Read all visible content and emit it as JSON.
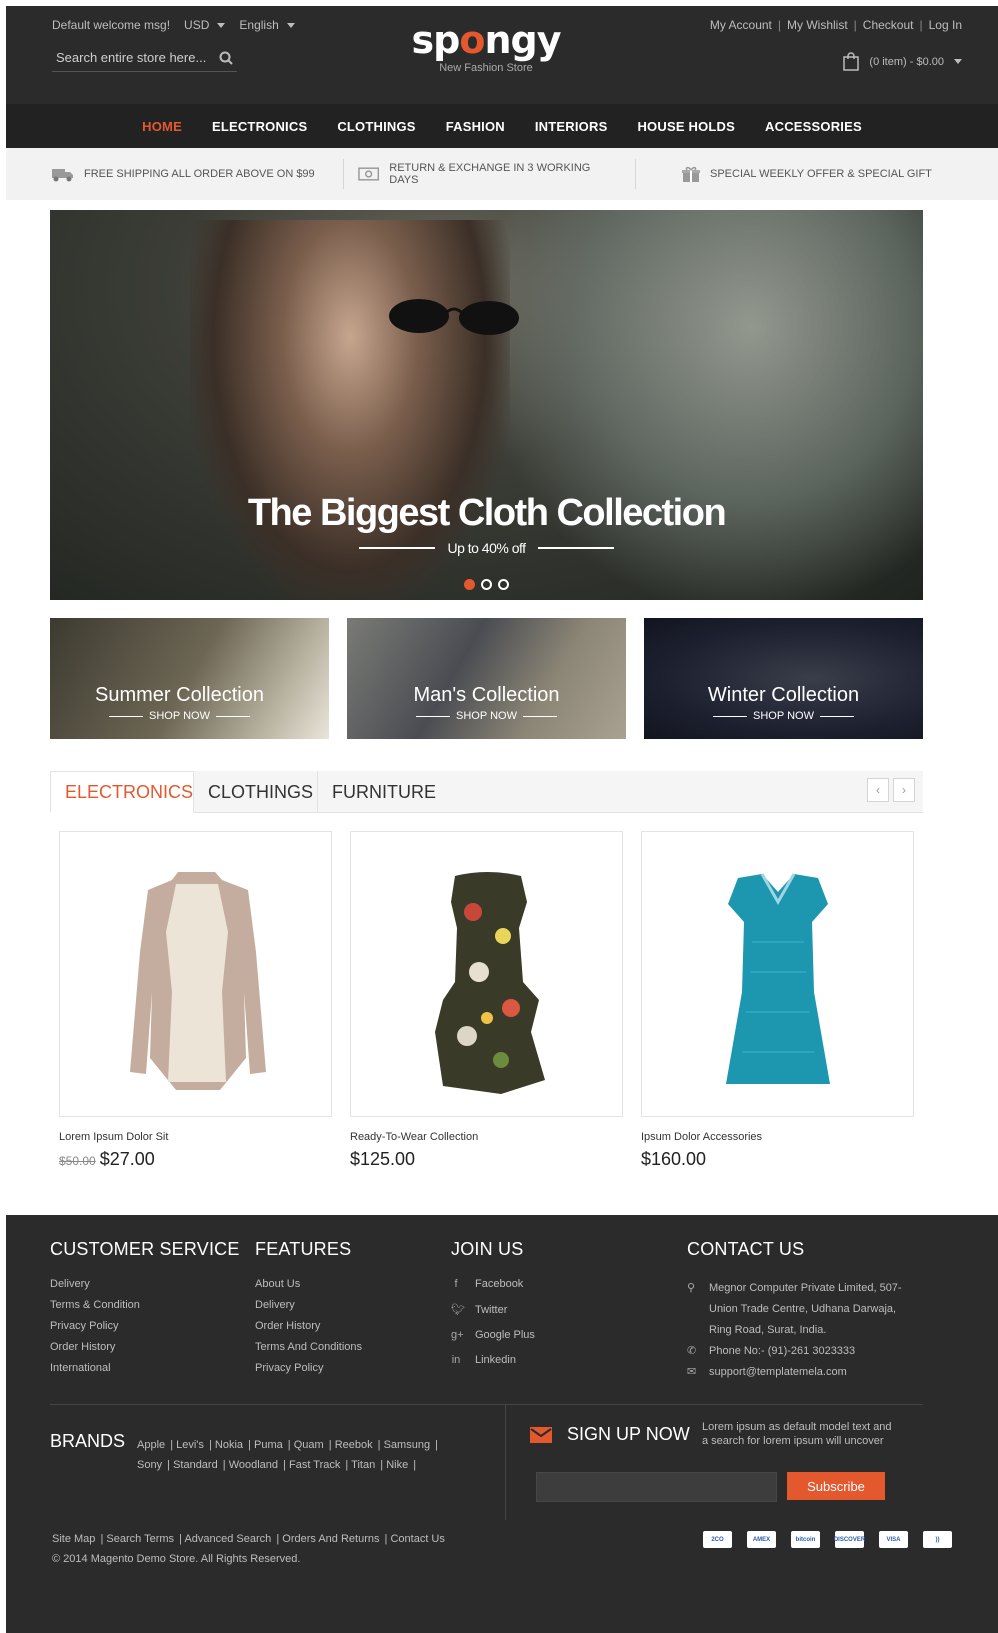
{
  "header": {
    "welcome": "Default welcome msg!",
    "currency": "USD",
    "language": "English",
    "search_placeholder": "Search entire store here...",
    "logo_text": "spongy",
    "logo_tagline": "New Fashion Store",
    "links": [
      "My Account",
      "My Wishlist",
      "Checkout",
      "Log In"
    ],
    "cart": "(0 item) - $0.00"
  },
  "nav": [
    "HOME",
    "ELECTRONICS",
    "CLOTHINGS",
    "FASHION",
    "INTERIORS",
    "HOUSE HOLDS",
    "ACCESSORIES"
  ],
  "features": [
    {
      "icon": "truck-icon",
      "text": "FREE SHIPPING ALL ORDER ABOVE ON $99"
    },
    {
      "icon": "money-icon",
      "text": "RETURN & EXCHANGE IN 3 WORKING DAYS"
    },
    {
      "icon": "gift-icon",
      "text": "SPECIAL WEEKLY OFFER & SPECIAL GIFT"
    }
  ],
  "hero": {
    "title": "The Biggest Cloth Collection",
    "subtitle": "Up to 40% off",
    "slides": 3,
    "active_slide": 1
  },
  "banners": [
    {
      "title": "Summer Collection",
      "cta": "SHOP NOW"
    },
    {
      "title": "Man's Collection",
      "cta": "SHOP NOW"
    },
    {
      "title": "Winter Collection",
      "cta": "SHOP NOW"
    }
  ],
  "tabs": [
    "ELECTRONICS",
    "CLOTHINGS",
    "FURNITURE"
  ],
  "products": [
    {
      "name": "Lorem Ipsum Dolor Sit",
      "old_price": "$50.00",
      "price": "$27.00"
    },
    {
      "name": "Ready-To-Wear Collection",
      "old_price": "",
      "price": "$125.00"
    },
    {
      "name": "Ipsum Dolor Accessories",
      "old_price": "",
      "price": "$160.00"
    }
  ],
  "footer": {
    "customer_service": {
      "title": "CUSTOMER SERVICE",
      "items": [
        "Delivery",
        "Terms & Condition",
        "Privacy Policy",
        "Order History",
        "International"
      ]
    },
    "features": {
      "title": "FEATURES",
      "items": [
        "About Us",
        "Delivery",
        "Order History",
        "Terms And Conditions",
        "Privacy Policy"
      ]
    },
    "join": {
      "title": "JOIN US",
      "items": [
        {
          "icon": "f",
          "label": "Facebook"
        },
        {
          "icon": "t",
          "label": "Twitter"
        },
        {
          "icon": "g+",
          "label": "Google Plus"
        },
        {
          "icon": "in",
          "label": "Linkedin"
        }
      ]
    },
    "contact": {
      "title": "CONTACT US",
      "address": [
        "Megnor Computer Private Limited, 507-",
        "Union Trade Centre, Udhana Darwaja,",
        "Ring Road, Surat, India."
      ],
      "phone": "Phone No:- (91)-261 3023333",
      "email": "support@templatemela.com"
    },
    "brands_title": "BRANDS",
    "brands": [
      "Apple",
      "Levi's",
      "Nokia",
      "Puma",
      "Quam",
      "Reebok",
      "Samsung",
      "Sony",
      "Standard",
      "Woodland",
      "Fast Track",
      "Titan",
      "Nike"
    ],
    "signup": {
      "title": "SIGN UP NOW",
      "desc": "Lorem ipsum as default model text and a search for lorem ipsum will uncover",
      "button": "Subscribe"
    },
    "bottom_links": [
      "Site Map",
      "Search Terms",
      "Advanced Search",
      "Orders And Returns",
      "Contact Us"
    ],
    "copyright": "© 2014 Magento Demo Store. All Rights Reserved.",
    "cards": [
      "2CO",
      "AMEX",
      "bitcoin",
      "DISCOVER",
      "VISA",
      "))"
    ]
  },
  "colors": {
    "accent": "#e4582e",
    "dark": "#2b2b2b",
    "nav": "#222222"
  }
}
